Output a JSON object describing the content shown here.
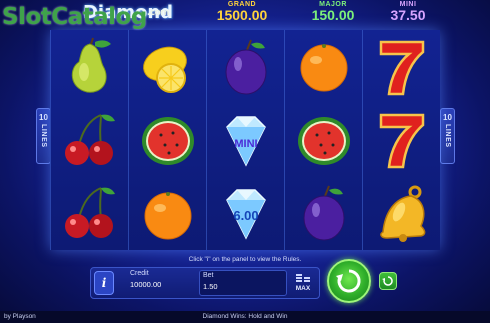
{
  "watermark": {
    "text": "SlotCatalog",
    "suffix": ".com"
  },
  "game_logo": "Diamond",
  "jackpots": [
    {
      "label": "GRAND",
      "value": "1500.00"
    },
    {
      "label": "MAJOR",
      "value": "150.00"
    },
    {
      "label": "MINI",
      "value": "37.50"
    }
  ],
  "lines": {
    "count": "10",
    "word": "LINES"
  },
  "reels": [
    [
      "pear",
      "cherries",
      "cherries"
    ],
    [
      "lemon",
      "watermelon",
      "orange"
    ],
    [
      "plum",
      "diamond",
      "diamond"
    ],
    [
      "orange",
      "watermelon",
      "plum"
    ],
    [
      "seven",
      "seven",
      "bell"
    ]
  ],
  "diamond_labels": {
    "top": "MINI",
    "bottom": "6.00"
  },
  "rules_hint": "Click \"i\" on the panel to view the Rules.",
  "panel": {
    "info_label": "i",
    "credit_label": "Credit",
    "credit_value": "10000.00",
    "bet_label": "Bet",
    "bet_value": "1.50",
    "max_label": "MAX"
  },
  "footer": {
    "provider": "by Playson",
    "game_name": "Diamond Wins: Hold and Win"
  },
  "colors": {
    "grand": "#ffd43b",
    "major": "#7df27a",
    "mini": "#d8a4ff",
    "spin": "#2fae2a"
  }
}
